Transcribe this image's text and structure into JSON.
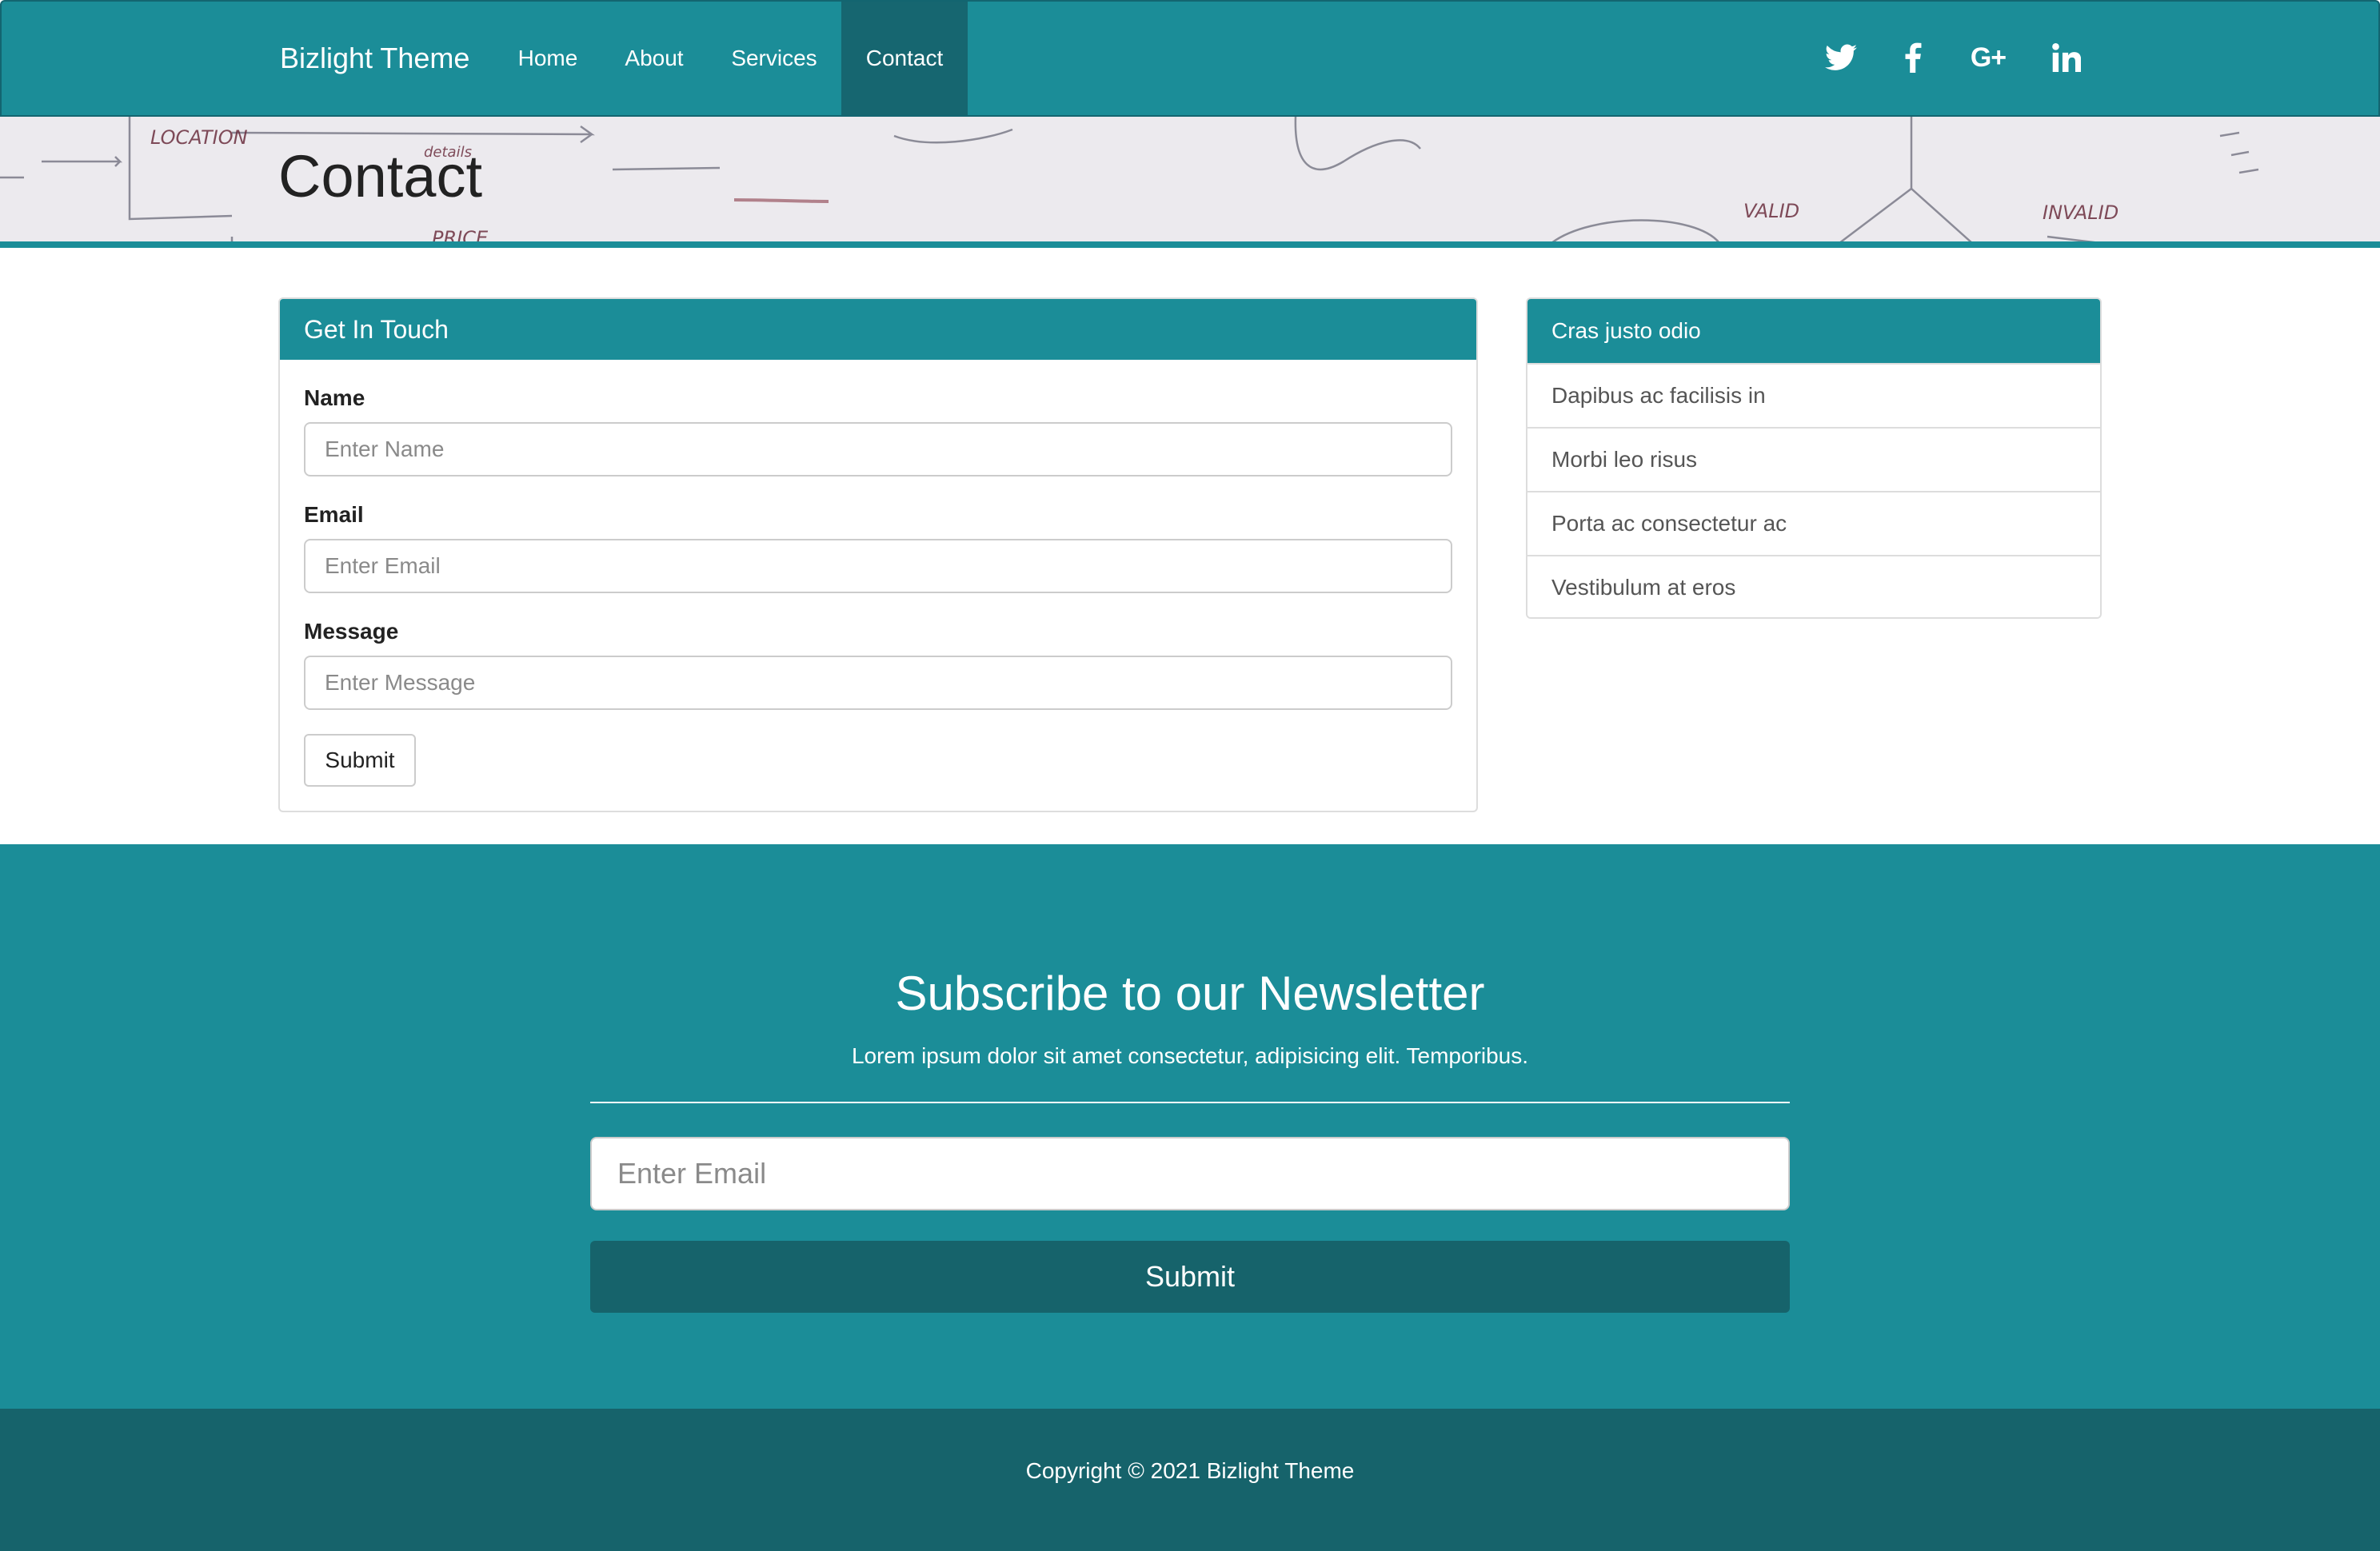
{
  "navbar": {
    "brand": "Bizlight Theme",
    "items": [
      {
        "label": "Home",
        "active": false
      },
      {
        "label": "About",
        "active": false
      },
      {
        "label": "Services",
        "active": false
      },
      {
        "label": "Contact",
        "active": true
      }
    ],
    "social": [
      "twitter-icon",
      "facebook-icon",
      "google-plus-icon",
      "linkedin-icon"
    ],
    "google_plus_glyph": "G+"
  },
  "hero": {
    "title": "Contact",
    "sketch_words": [
      "LOCATION",
      "details",
      "PRICE",
      "VALID",
      "INVALID"
    ]
  },
  "contact_form": {
    "heading": "Get In Touch",
    "fields": [
      {
        "label": "Name",
        "placeholder": "Enter Name",
        "value": ""
      },
      {
        "label": "Email",
        "placeholder": "Enter Email",
        "value": ""
      },
      {
        "label": "Message",
        "placeholder": "Enter Message",
        "value": ""
      }
    ],
    "submit_label": "Submit"
  },
  "list_group": {
    "heading": "Cras justo odio",
    "items": [
      "Dapibus ac facilisis in",
      "Morbi leo risus",
      "Porta ac consectetur ac",
      "Vestibulum at eros"
    ]
  },
  "newsletter": {
    "title": "Subscribe to our Newsletter",
    "text": "Lorem ipsum dolor sit amet consectetur, adipisicing elit. Temporibus.",
    "email_placeholder": "Enter Email",
    "email_value": "",
    "submit_label": "Submit"
  },
  "footer": {
    "copyright": "Copyright © 2021 Bizlight Theme"
  },
  "colors": {
    "primary": "#1b8d98",
    "primary_dark": "#16636b",
    "hero_bg": "#eceaee",
    "border": "#dddddd"
  }
}
